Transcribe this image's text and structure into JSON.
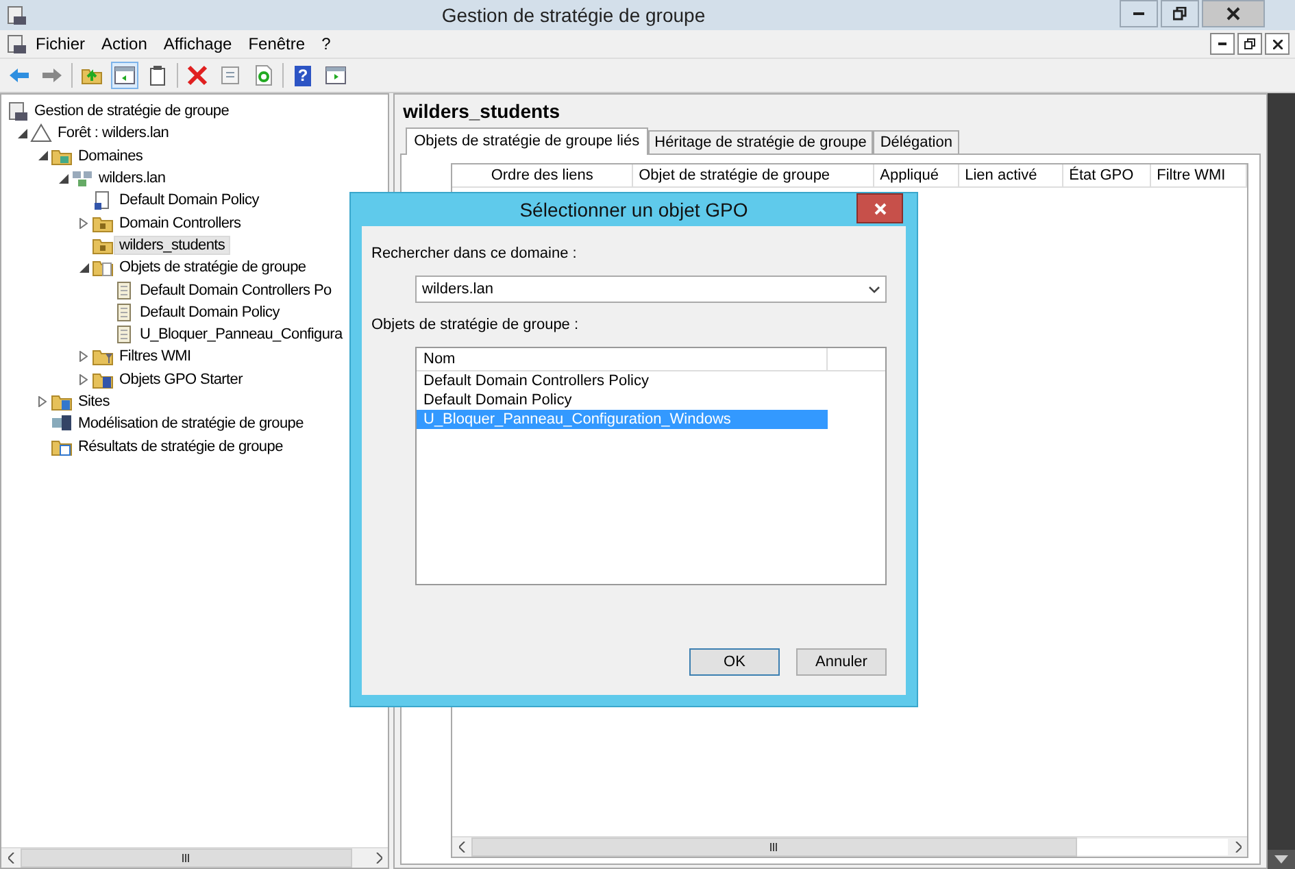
{
  "window": {
    "title": "Gestion de stratégie de groupe"
  },
  "menu": [
    "Fichier",
    "Action",
    "Affichage",
    "Fenêtre",
    "?"
  ],
  "toolbar": [
    {
      "kind": "back",
      "pressed": false
    },
    {
      "kind": "forward",
      "pressed": false
    },
    {
      "kind": "sep"
    },
    {
      "kind": "up",
      "pressed": false
    },
    {
      "kind": "tree",
      "pressed": true
    },
    {
      "kind": "clipboard",
      "pressed": false
    },
    {
      "kind": "sep"
    },
    {
      "kind": "delete",
      "pressed": false
    },
    {
      "kind": "properties",
      "pressed": false
    },
    {
      "kind": "refresh",
      "pressed": false
    },
    {
      "kind": "sep"
    },
    {
      "kind": "help",
      "pressed": false,
      "glyph": "?"
    },
    {
      "kind": "pane",
      "pressed": false
    }
  ],
  "tree": [
    {
      "label": "Gestion de stratégie de groupe",
      "kind": "root",
      "selected": false,
      "children": [
        {
          "label": "Forêt : wilders.lan",
          "kind": "forest",
          "expanded": true,
          "selected": false,
          "children": [
            {
              "label": "Domaines",
              "kind": "domains",
              "expanded": true,
              "selected": false,
              "children": [
                {
                  "label": "wilders.lan",
                  "kind": "domain",
                  "expanded": true,
                  "selected": false,
                  "children": [
                    {
                      "label": "Default Domain Policy",
                      "kind": "link",
                      "selected": false
                    },
                    {
                      "label": "Domain Controllers",
                      "kind": "ou",
                      "expanded": false,
                      "selected": false
                    },
                    {
                      "label": "wilders_students",
                      "kind": "ou",
                      "selected": true
                    },
                    {
                      "label": "Objets de stratégie de groupe",
                      "kind": "container",
                      "expanded": true,
                      "selected": false,
                      "children": [
                        {
                          "label": "Default Domain Controllers Po",
                          "kind": "gpo",
                          "selected": false
                        },
                        {
                          "label": "Default Domain Policy",
                          "kind": "gpo",
                          "selected": false
                        },
                        {
                          "label": "U_Bloquer_Panneau_Configura",
                          "kind": "gpo",
                          "selected": false
                        }
                      ]
                    },
                    {
                      "label": "Filtres WMI",
                      "kind": "wmi",
                      "expanded": false,
                      "selected": false
                    },
                    {
                      "label": "Objets GPO Starter",
                      "kind": "starter",
                      "expanded": false,
                      "selected": false
                    }
                  ]
                }
              ]
            },
            {
              "label": "Sites",
              "kind": "sites",
              "expanded": false,
              "selected": false
            },
            {
              "label": "Modélisation de stratégie de groupe",
              "kind": "modeling",
              "selected": false
            },
            {
              "label": "Résultats de stratégie de groupe",
              "kind": "results",
              "selected": false
            }
          ]
        }
      ]
    }
  ],
  "detail": {
    "title": "wilders_students",
    "tabs": [
      {
        "label": "Objets de stratégie de groupe liés",
        "selected": true
      },
      {
        "label": "Héritage de stratégie de groupe",
        "selected": false
      },
      {
        "label": "Délégation",
        "selected": false
      }
    ],
    "columns": [
      "Ordre des liens",
      "Objet de stratégie de groupe",
      "Appliqué",
      "Lien activé",
      "État GPO",
      "Filtre WMI"
    ]
  },
  "dialog": {
    "title": "Sélectionner un objet GPO",
    "domain_label": "Rechercher dans ce domaine :",
    "domain_value": "wilders.lan",
    "list_label": "Objets de stratégie de groupe :",
    "list_column": "Nom",
    "items": [
      {
        "label": "Default Domain Controllers Policy",
        "selected": false
      },
      {
        "label": "Default Domain Policy",
        "selected": false
      },
      {
        "label": "U_Bloquer_Panneau_Configuration_Windows",
        "selected": true
      }
    ],
    "buttons": [
      {
        "label": "OK",
        "default": true
      },
      {
        "label": "Annuler",
        "default": false
      }
    ]
  }
}
